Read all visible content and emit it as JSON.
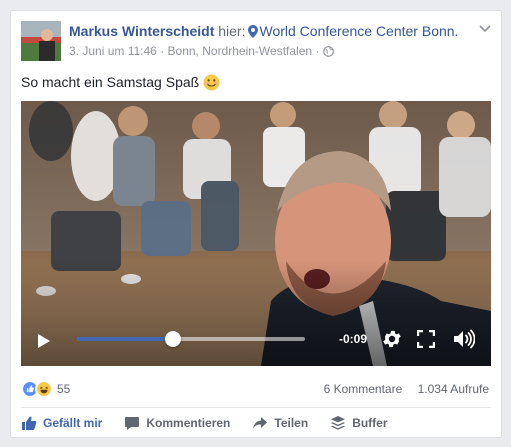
{
  "post": {
    "author": "Markus Winterscheidt",
    "at_word": "hier:",
    "location": "World Conference Center Bonn.",
    "date": "3. Juni um 11:46",
    "separator1": "·",
    "place": "Bonn, Nordrhein-Westfalen",
    "separator2": "·",
    "privacy_icon": "globe-icon",
    "text": "So macht ein Samstag Spaß",
    "emoji_icon": "smiling-face-icon"
  },
  "video": {
    "progress_fraction": 0.42,
    "time_remaining": "-0:09",
    "progress_color": "#4267b2"
  },
  "engagement": {
    "reaction_icons": [
      "like-icon",
      "haha-icon"
    ],
    "reaction_count": "55",
    "comments": "6 Kommentare",
    "views": "1.034 Aufrufe"
  },
  "actions": {
    "like": "Gefällt mir",
    "comment": "Kommentieren",
    "share": "Teilen",
    "buffer": "Buffer"
  },
  "colors": {
    "link": "#365899",
    "accent": "#4267b2",
    "muted": "#90949c"
  }
}
